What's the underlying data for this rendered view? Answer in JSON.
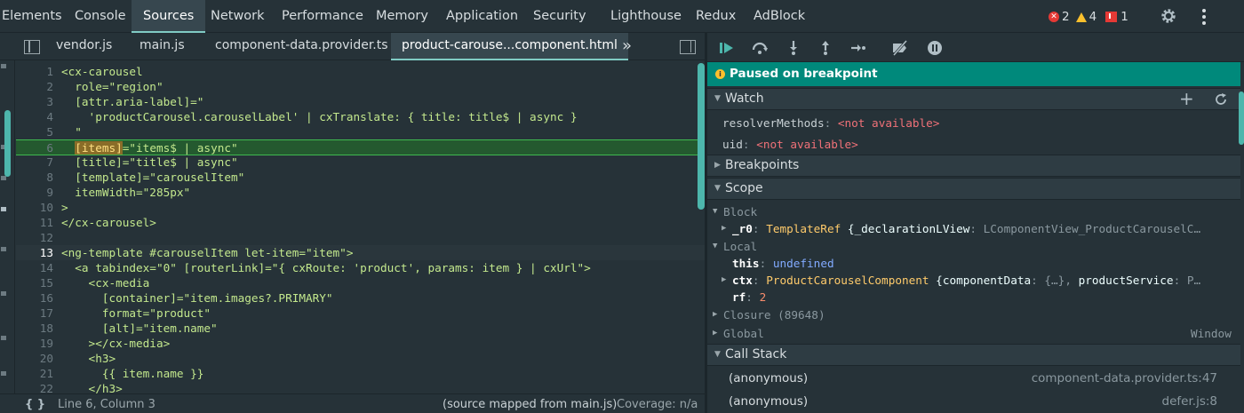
{
  "toptabs": [
    "Elements",
    "Console",
    "Sources",
    "Network",
    "Performance",
    "Memory",
    "Application",
    "Security",
    "Lighthouse",
    "Redux",
    "AdBlock"
  ],
  "active_toptab": "Sources",
  "status": {
    "errors": "2",
    "warnings": "4",
    "issues": "1"
  },
  "filetabs": [
    "vendor.js",
    "main.js",
    "component-data.provider.ts",
    "product-carouse...component.html"
  ],
  "more_tabs": "»",
  "code": {
    "lines": [
      {
        "n": "1",
        "t": "<cx-carousel"
      },
      {
        "n": "2",
        "t": "  role=\"region\""
      },
      {
        "n": "3",
        "t": "  [attr.aria-label]=\""
      },
      {
        "n": "4",
        "t": "    'productCarousel.carouselLabel' | cxTranslate: { title: title$ | async }"
      },
      {
        "n": "5",
        "t": "  \""
      },
      {
        "n": "6",
        "t": "=\"items$ | async\"",
        "pre": "  ",
        "sel": "[items]"
      },
      {
        "n": "7",
        "t": "  [title]=\"title$ | async\""
      },
      {
        "n": "8",
        "t": "  [template]=\"carouselItem\""
      },
      {
        "n": "9",
        "t": "  itemWidth=\"285px\""
      },
      {
        "n": "10",
        "t": ">"
      },
      {
        "n": "11",
        "t": "</cx-carousel>"
      },
      {
        "n": "12",
        "t": ""
      },
      {
        "n": "13",
        "t": "<ng-template #carouselItem let-item=\"item\">"
      },
      {
        "n": "14",
        "t": "  <a tabindex=\"0\" [routerLink]=\"{ cxRoute: 'product', params: item } | cxUrl\">"
      },
      {
        "n": "15",
        "t": "    <cx-media"
      },
      {
        "n": "16",
        "t": "      [container]=\"item.images?.PRIMARY\""
      },
      {
        "n": "17",
        "t": "      format=\"product\""
      },
      {
        "n": "18",
        "t": "      [alt]=\"item.name\""
      },
      {
        "n": "19",
        "t": "    ></cx-media>"
      },
      {
        "n": "20",
        "t": "    <h3>"
      },
      {
        "n": "21",
        "t": "      {{ item.name }}"
      },
      {
        "n": "22",
        "t": "    </h3>"
      }
    ]
  },
  "statusbar": {
    "braces": "{ }",
    "position": "Line 6, Column 3",
    "mapped": "(source mapped from main.js)",
    "coverage": "Coverage: n/a"
  },
  "debugger": {
    "paused": "Paused on breakpoint",
    "watch": {
      "title": "Watch",
      "items": [
        {
          "name": "resolverMethods",
          "value": "<not available>"
        },
        {
          "name": "uid",
          "value": "<not available>"
        }
      ]
    },
    "breakpoints": "Breakpoints",
    "scope": {
      "title": "Scope",
      "block": "Block",
      "r0": {
        "name": "_r0",
        "type": "TemplateRef",
        "open": "{",
        "k": "_declarationLView",
        "v": "LComponentView_ProductCarouselC…"
      },
      "local": "Local",
      "this": {
        "name": "this",
        "value": "undefined"
      },
      "ctx": {
        "name": "ctx",
        "type": "ProductCarouselComponent",
        "open": "{",
        "k1": "componentData",
        "v1": "{…}",
        "k2": "productService",
        "v2": "P…"
      },
      "rf": {
        "name": "rf",
        "value": "2"
      },
      "closure": "Closure (89648)",
      "global": "Global",
      "global_value": "Window"
    },
    "callstack": {
      "title": "Call Stack",
      "frames": [
        {
          "fn": "(anonymous)",
          "loc": "component-data.provider.ts:47"
        },
        {
          "fn": "(anonymous)",
          "loc": "defer.js:8"
        }
      ]
    }
  },
  "colors": {
    "accent": "#80cbc4",
    "paused_bg": "#00897b",
    "exec_line": "#24592f"
  }
}
